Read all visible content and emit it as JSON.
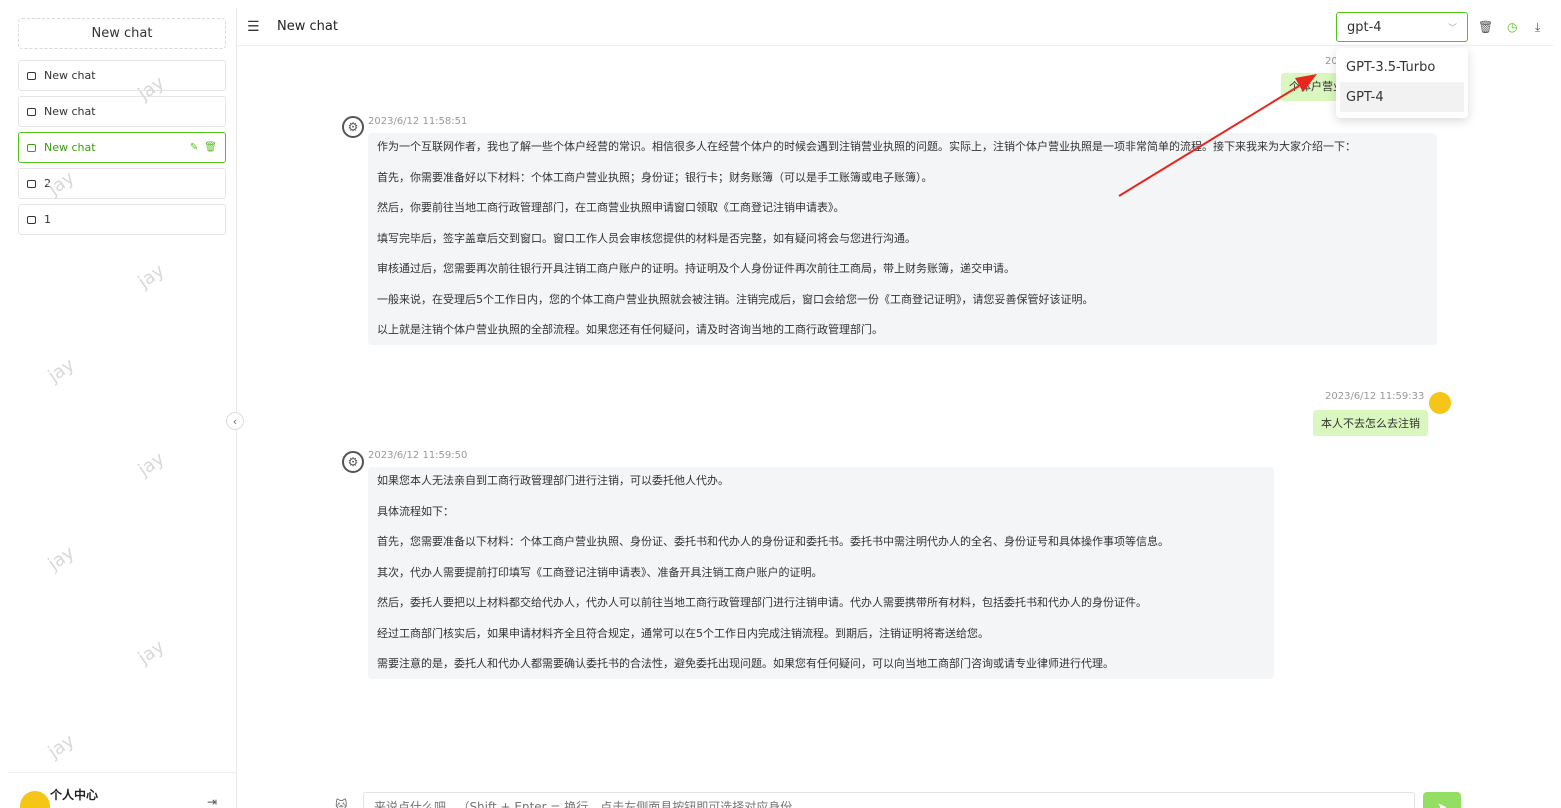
{
  "sidebar": {
    "new_chat_label": "New chat",
    "items": [
      {
        "label": "New chat"
      },
      {
        "label": "New chat"
      },
      {
        "label": "New chat"
      },
      {
        "label": "2"
      },
      {
        "label": "1"
      }
    ],
    "user_center_label": "个人中心",
    "watermark": "jay"
  },
  "header": {
    "title": "New chat",
    "model_selected": "gpt-4",
    "model_options": [
      "GPT-3.5-Turbo",
      "GPT-4"
    ]
  },
  "messages": [
    {
      "role": "user-partial",
      "time": "20",
      "text": "个体户营业"
    },
    {
      "role": "bot",
      "time": "2023/6/12 11:58:51",
      "paragraphs": [
        "作为一个互联网作者，我也了解一些个体户经营的常识。相信很多人在经营个体户的时候会遇到注销营业执照的问题。实际上，注销个体户营业执照是一项非常简单的流程。接下来我来为大家介绍一下：",
        "首先，你需要准备好以下材料：个体工商户营业执照；身份证；银行卡；财务账簿（可以是手工账簿或电子账簿）。",
        "然后，你要前往当地工商行政管理部门，在工商营业执照申请窗口领取《工商登记注销申请表》。",
        "填写完毕后，签字盖章后交到窗口。窗口工作人员会审核您提供的材料是否完整，如有疑问将会与您进行沟通。",
        "审核通过后，您需要再次前往银行开具注销工商户账户的证明。持证明及个人身份证件再次前往工商局，带上财务账簿，递交申请。",
        "一般来说，在受理后5个工作日内，您的个体工商户营业执照就会被注销。注销完成后，窗口会给您一份《工商登记证明》，请您妥善保管好该证明。",
        "以上就是注销个体户营业执照的全部流程。如果您还有任何疑问，请及时咨询当地的工商行政管理部门。"
      ]
    },
    {
      "role": "user",
      "time": "2023/6/12 11:59:33",
      "text": "本人不去怎么去注销"
    },
    {
      "role": "bot",
      "time": "2023/6/12 11:59:50",
      "paragraphs": [
        "如果您本人无法亲自到工商行政管理部门进行注销，可以委托他人代办。",
        "具体流程如下：",
        "首先，您需要准备以下材料：个体工商户营业执照、身份证、委托书和代办人的身份证和委托书。委托书中需注明代办人的全名、身份证号和具体操作事项等信息。",
        "其次，代办人需要提前打印填写《工商登记注销申请表》、准备开具注销工商户账户的证明。",
        "然后，委托人要把以上材料都交给代办人，代办人可以前往当地工商行政管理部门进行注销申请。代办人需要携带所有材料，包括委托书和代办人的身份证件。",
        "经过工商部门核实后，如果申请材料齐全且符合规定，通常可以在5个工作日内完成注销流程。到期后，注销证明将寄送给您。",
        "需要注意的是，委托人和代办人都需要确认委托书的合法性，避免委托出现问题。如果您有任何疑问，可以向当地工商部门咨询或请专业律师进行代理。"
      ]
    }
  ],
  "input": {
    "placeholder": "来说点什么吧...（Shift + Enter = 换行，点击左侧面具按钮即可选择对应身份"
  },
  "colors": {
    "accent": "#52c41a",
    "user_bubble": "#d9f7be",
    "bot_bubble": "#f4f5f7",
    "arrow": "#e8261f"
  }
}
